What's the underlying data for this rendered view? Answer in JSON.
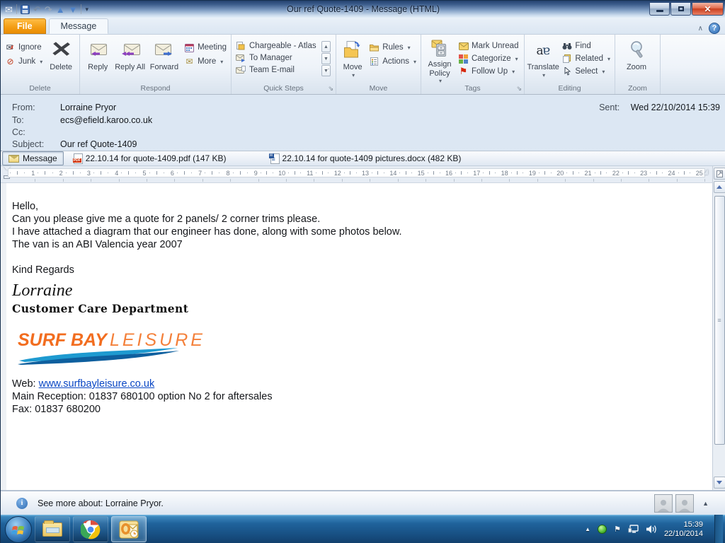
{
  "window": {
    "title": "Our ref Quote-1409  -  Message (HTML)"
  },
  "ribbon": {
    "tabs": [
      {
        "label": "File"
      },
      {
        "label": "Message"
      }
    ],
    "groups": {
      "delete": {
        "label": "Delete",
        "ignore": "Ignore",
        "junk": "Junk",
        "delete_btn": "Delete"
      },
      "respond": {
        "label": "Respond",
        "reply": "Reply",
        "reply_all": "Reply All",
        "forward": "Forward",
        "meeting": "Meeting",
        "more": "More"
      },
      "quick_steps": {
        "label": "Quick Steps",
        "items": [
          "Chargeable - Atlas",
          "To Manager",
          "Team E-mail"
        ]
      },
      "move": {
        "label": "Move",
        "move_btn": "Move",
        "rules": "Rules",
        "actions": "Actions"
      },
      "tags": {
        "label": "Tags",
        "assign_policy": "Assign Policy",
        "mark_unread": "Mark Unread",
        "categorize": "Categorize",
        "follow_up": "Follow Up"
      },
      "editing": {
        "label": "Editing",
        "translate": "Translate",
        "find": "Find",
        "related": "Related",
        "select": "Select"
      },
      "zoom": {
        "label": "Zoom",
        "zoom_btn": "Zoom"
      }
    }
  },
  "header": {
    "from_label": "From:",
    "from_value": "Lorraine Pryor",
    "to_label": "To:",
    "to_value": "ecs@efield.karoo.co.uk",
    "cc_label": "Cc:",
    "cc_value": "",
    "subject_label": "Subject:",
    "subject_value": "Our ref Quote-1409",
    "sent_label": "Sent:",
    "sent_value": "Wed 22/10/2014 15:39"
  },
  "attachments": {
    "message_tab": "Message",
    "items": [
      {
        "name": "22.10.14  for quote-1409.pdf (147 KB)",
        "type": "pdf"
      },
      {
        "name": "22.10.14 for quote-1409 pictures.docx (482 KB)",
        "type": "docx"
      }
    ]
  },
  "ruler": {
    "numbers": [
      1,
      2,
      3,
      4,
      5,
      6,
      7,
      8,
      9,
      10,
      11,
      12,
      13,
      14,
      15,
      16,
      17,
      18,
      19,
      20,
      21,
      22,
      23,
      24,
      25
    ]
  },
  "body": {
    "line1": "Hello,",
    "line2": "Can you please give me a quote for 2 panels/ 2 corner trims please.",
    "line3": "I have attached a diagram that our engineer has done, along with some photos below.",
    "line4": "The van is an ABI Valencia year 2007",
    "regards": "Kind Regards",
    "signature_name": "Lorraine",
    "signature_title": "Customer Care Department",
    "logo_part1": "SURF BAY",
    "logo_part2": "LEISURE",
    "web_label": "Web: ",
    "web_link": "www.surfbayleisure.co.uk",
    "reception_line": "Main Reception:  01837 680100 option No 2 for aftersales",
    "fax_line": "Fax:  01837 680200"
  },
  "people_pane": {
    "see_more": "See more about: Lorraine Pryor."
  },
  "taskbar": {
    "time": "15:39",
    "date": "22/10/2014"
  },
  "colors": {
    "accent_orange": "#f39c12",
    "link_blue": "#0a47c4",
    "logo_orange": "#f26d1f",
    "wave_blue": "#1e9ad0"
  }
}
